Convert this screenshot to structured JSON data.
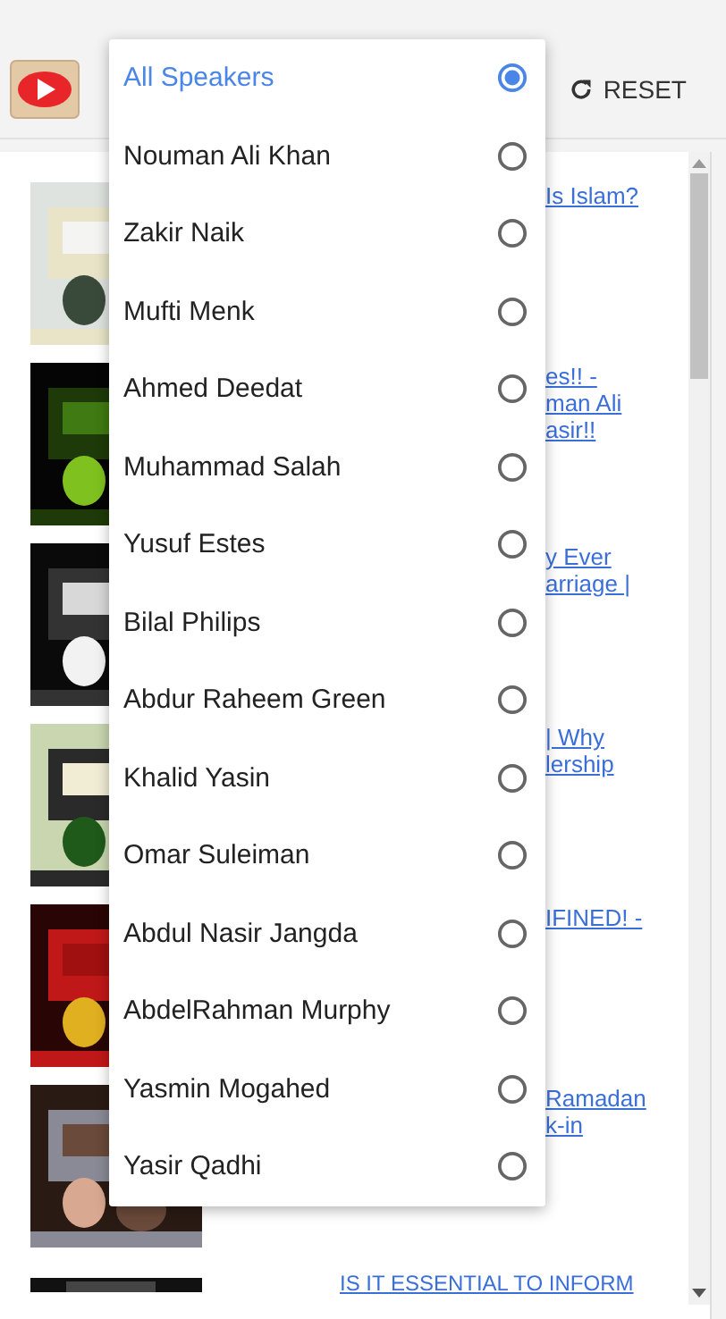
{
  "header": {
    "reset_label": "RESET"
  },
  "videos": [
    {
      "thumbnail": {
        "kind": "picture"
      },
      "title_lines": [
        "Is Islam?"
      ]
    },
    {
      "thumbnail": {
        "kind": "picture"
      },
      "title_lines": [
        "es!! -",
        "man Ali",
        "asir!!"
      ]
    },
    {
      "thumbnail": {
        "kind": "picture"
      },
      "title_lines": [
        "y Ever",
        "arriage |"
      ]
    },
    {
      "thumbnail": {
        "kind": "picture"
      },
      "title_lines": [
        "| Why",
        "lership"
      ]
    },
    {
      "thumbnail": {
        "kind": "picture"
      },
      "title_lines": [
        "IFINED! -"
      ]
    },
    {
      "thumbnail": {
        "kind": "picture"
      },
      "title_lines": [
        "Ramadan",
        "k-in"
      ]
    }
  ],
  "next_video": {
    "title": "IS IT ESSENTIAL TO INFORM"
  },
  "speaker_menu": {
    "options": [
      {
        "label": "All Speakers",
        "selected": true
      },
      {
        "label": "Nouman Ali Khan",
        "selected": false
      },
      {
        "label": "Zakir Naik",
        "selected": false
      },
      {
        "label": "Mufti Menk",
        "selected": false
      },
      {
        "label": "Ahmed Deedat",
        "selected": false
      },
      {
        "label": "Muhammad Salah",
        "selected": false
      },
      {
        "label": "Yusuf Estes",
        "selected": false
      },
      {
        "label": "Bilal Philips",
        "selected": false
      },
      {
        "label": "Abdur Raheem Green",
        "selected": false
      },
      {
        "label": "Khalid Yasin",
        "selected": false
      },
      {
        "label": "Omar Suleiman",
        "selected": false
      },
      {
        "label": "Abdul Nasir Jangda",
        "selected": false
      },
      {
        "label": "AbdelRahman Murphy",
        "selected": false
      },
      {
        "label": "Yasmin Mogahed",
        "selected": false
      },
      {
        "label": "Yasir Qadhi",
        "selected": false
      }
    ]
  }
}
